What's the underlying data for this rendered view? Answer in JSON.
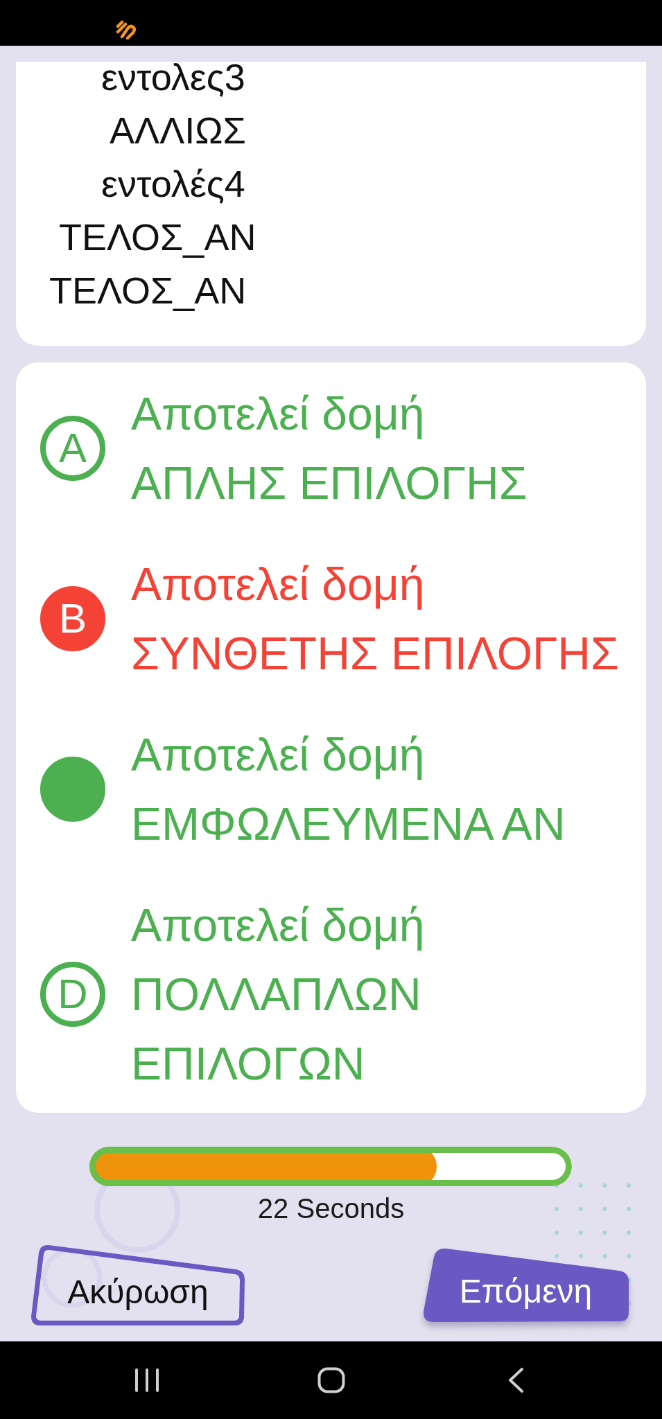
{
  "question": {
    "code_lines": [
      "     εντολες3",
      "      ΑΛΛΙΩΣ",
      "     εντολές4",
      " ΤΕΛΟΣ_ΑΝ",
      "ΤΕΛΟΣ_ΑΝ"
    ]
  },
  "answers": [
    {
      "letter": "A",
      "text": "Αποτελεί δομή\nΑΠΛΗΣ ΕΠΙΛΟΓΗΣ",
      "selected": false,
      "correct": false
    },
    {
      "letter": "B",
      "text": "Αποτελεί δομή\nΣΥΝΘΕΤΗΣ ΕΠΙΛΟΓΗΣ",
      "selected": true,
      "correct": false
    },
    {
      "text": "Αποτελεί δομή\nΕΜΦΩΛΕΥΜΕΝΑ ΑΝ",
      "selected": false,
      "correct": true
    },
    {
      "letter": "D",
      "text": "Αποτελεί δομή\nΠΟΛΛΑΠΛΩΝ ΕΠΙΛΟΓΩΝ",
      "selected": false,
      "correct": false
    }
  ],
  "timer": {
    "level": 0.72,
    "label": "22 Seconds"
  },
  "buttons": [
    {
      "kind": "outline",
      "label": "Ακύρωση"
    },
    {
      "kind": "filled",
      "label": "Επόμενη"
    }
  ]
}
